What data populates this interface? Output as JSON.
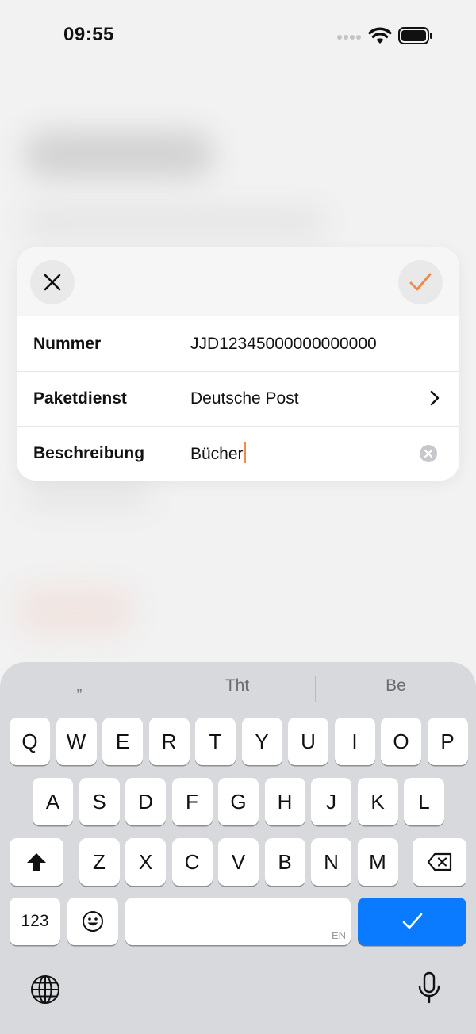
{
  "status_bar": {
    "time": "09:55"
  },
  "sheet": {
    "rows": [
      {
        "label": "Nummer",
        "value": "JJD12345000000000000"
      },
      {
        "label": "Paketdienst",
        "value": "Deutsche Post"
      },
      {
        "label": "Beschreibung",
        "value": "Bücher"
      }
    ]
  },
  "colors": {
    "accent": "#f08a4b",
    "keyboard_done": "#0a7bff"
  },
  "keyboard": {
    "suggestions": [
      "„",
      "Tht",
      "Be"
    ],
    "row1": [
      "Q",
      "W",
      "E",
      "R",
      "T",
      "Y",
      "U",
      "I",
      "O",
      "P"
    ],
    "row2": [
      "A",
      "S",
      "D",
      "F",
      "G",
      "H",
      "J",
      "K",
      "L"
    ],
    "row3": [
      "Z",
      "X",
      "C",
      "V",
      "B",
      "N",
      "M"
    ],
    "numbers_label": "123",
    "space_hint": "EN"
  }
}
